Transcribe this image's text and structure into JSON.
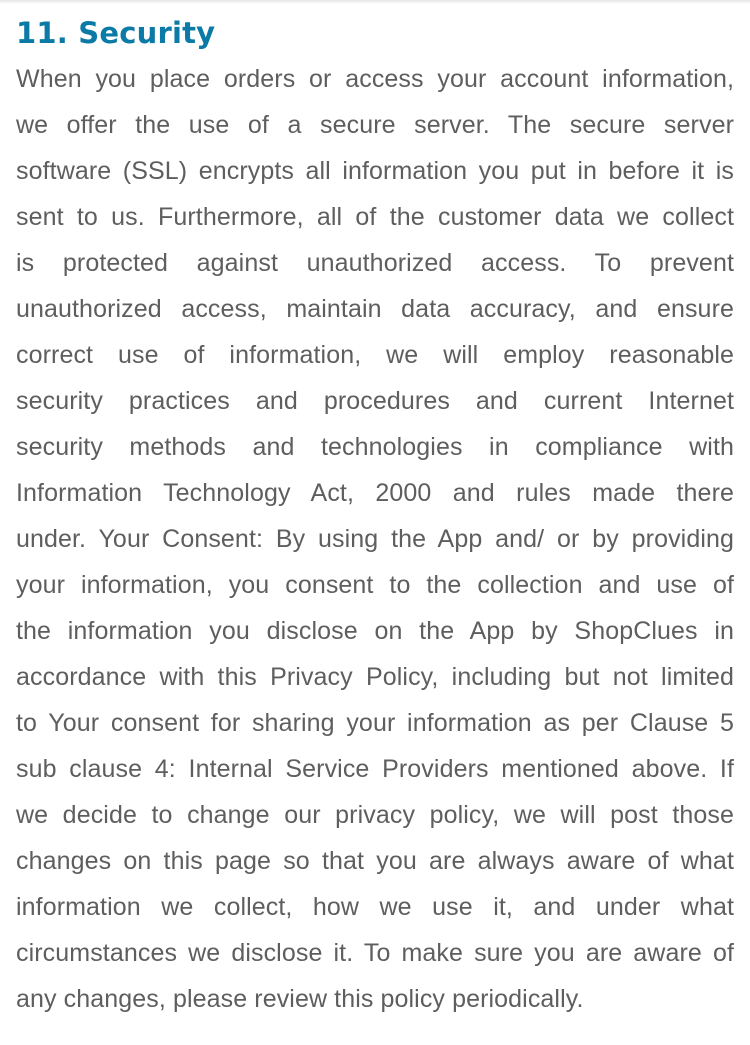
{
  "section": {
    "heading": "11. Security",
    "colors": {
      "heading": "#0b7aa6",
      "body": "#5e5e5e"
    },
    "lines": [
      "When you place orders or access your account information,",
      "we offer the use of a secure server. The secure server",
      "software (SSL) encrypts all information you put in before it is",
      "sent to us. Furthermore, all of the customer data we collect",
      "is protected against unauthorized access. To prevent",
      "unauthorized access, maintain data accuracy, and ensure",
      "correct use of information, we will employ reasonable",
      "security practices and procedures and current Internet",
      "security methods and technologies in compliance with",
      "Information Technology Act, 2000 and rules made there",
      "under. Your Consent: By using the App and/ or by providing",
      "your information, you consent to the collection and use of",
      "the information you disclose on the App by ShopClues in",
      "accordance with this Privacy Policy, including but not limited",
      "to Your consent for sharing your information as per Clause 5",
      "sub clause 4: Internal Service Providers mentioned above. If",
      "we decide to change our privacy policy, we will post those",
      "changes on this page so that you are always aware of what",
      "information we collect, how we use it, and under what",
      "circumstances we disclose it. To make sure you are aware of",
      "any changes, please review this policy periodically."
    ]
  }
}
